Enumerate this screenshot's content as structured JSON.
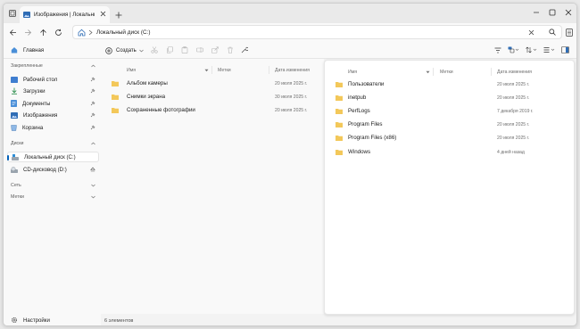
{
  "titlebar": {
    "tab_title": "Изображения | Локальный диск",
    "window_controls": [
      "minimize-icon",
      "maximize-icon",
      "close-icon"
    ]
  },
  "navigation": {
    "path": "Локальный диск (C:)"
  },
  "toolbar": {
    "new_label": "Создать"
  },
  "sidebar": {
    "home": "Главная",
    "quick_access_heading": "Закрепленные",
    "quick_access": [
      {
        "label": "Рабочий стол",
        "icon": "desktop-icon"
      },
      {
        "label": "Загрузки",
        "icon": "downloads-icon"
      },
      {
        "label": "Документы",
        "icon": "documents-icon"
      },
      {
        "label": "Изображения",
        "icon": "pictures-icon"
      },
      {
        "label": "Корзина",
        "icon": "recycle-bin-icon"
      }
    ],
    "drives_heading": "Диски",
    "drives": [
      {
        "label": "Локальный диск (C:)",
        "icon": "drive-icon"
      },
      {
        "label": "CD-дисковод (D:)",
        "icon": "cd-drive-icon"
      }
    ],
    "network_heading": "Сеть",
    "tags_heading": "Метки",
    "settings": "Настройки"
  },
  "left_pane": {
    "columns": [
      "Имя",
      "Метки",
      "Дата изменения"
    ],
    "rows": [
      {
        "name": "Альбом камеры",
        "date": "20 июля 2025 г."
      },
      {
        "name": "Снимки экрана",
        "date": "30 июля 2025 г."
      },
      {
        "name": "Сохраненные фотографии",
        "date": "20 июля 2025 г."
      }
    ]
  },
  "right_pane": {
    "columns": [
      "Имя",
      "Метки",
      "Дата изменения"
    ],
    "rows": [
      {
        "name": "Пользователи",
        "date": "20 июля 2025 г."
      },
      {
        "name": "inetpub",
        "date": "20 июля 2025 г."
      },
      {
        "name": "PerfLogs",
        "date": "7 декабря 2019 г."
      },
      {
        "name": "Program Files",
        "date": "20 июля 2025 г."
      },
      {
        "name": "Program Files (x86)",
        "date": "20 июля 2025 г."
      },
      {
        "name": "Windows",
        "date": "4 дней назад"
      }
    ]
  },
  "status_bar": {
    "item_count": "6 элементов"
  },
  "colors": {
    "accent": "#005fb8",
    "folder": "#f3c85a"
  }
}
